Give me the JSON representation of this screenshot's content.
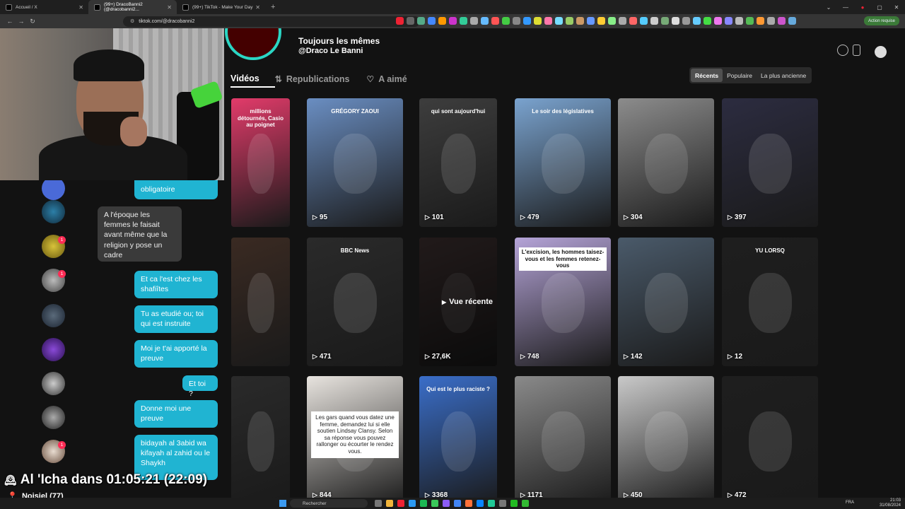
{
  "browser": {
    "tabs": [
      {
        "title": "Accueil / X",
        "active": false
      },
      {
        "title": "(99+) DracoBanni2 (@dracobanni2...",
        "active": true
      },
      {
        "title": "(99+) TikTok - Make Your Day",
        "active": false
      }
    ],
    "url": "tiktok.com/@dracobanni2",
    "action_pill": "Action requise"
  },
  "profile": {
    "bio_line1": "Toujours les mêmes",
    "bio_line2": "@Draco Le Banni",
    "tabs": [
      {
        "label": "Vidéos",
        "icon": "grid-icon",
        "active": true
      },
      {
        "label": "Republications",
        "icon": "repost-icon",
        "active": false
      },
      {
        "label": "A aimé",
        "icon": "heart-icon",
        "active": false
      }
    ],
    "sort_options": [
      {
        "label": "Récents",
        "active": true
      },
      {
        "label": "Populaire",
        "active": false
      },
      {
        "label": "La plus ancienne",
        "active": false
      }
    ]
  },
  "videos": [
    {
      "views": "",
      "caption": "millions détournés, Casio au poignet",
      "accent": "#e23b6a"
    },
    {
      "views": "95",
      "caption": "GRÉGORY ZAOUI",
      "accent": "#6a8ec2"
    },
    {
      "views": "101",
      "caption": "qui sont aujourd'hui",
      "accent": "#3d3d3d"
    },
    {
      "views": "479",
      "caption": "Le soir des législatives",
      "accent": "#7aa3cf"
    },
    {
      "views": "304",
      "caption": "",
      "accent": "#8c8c8c"
    },
    {
      "views": "397",
      "caption": "",
      "accent": "#2c2c40"
    },
    {
      "views": "",
      "caption": "",
      "accent": "#3a2a22"
    },
    {
      "views": "471",
      "caption": "BBC News",
      "accent": "#2a2a2a"
    },
    {
      "views": "27,6K",
      "caption": "Vue récente",
      "accent": "#4a3a3a"
    },
    {
      "views": "748",
      "caption": "L'excision, les hommes taisez-vous et les femmes retenez-vous",
      "accent": "#b5a4d8"
    },
    {
      "views": "142",
      "caption": "",
      "accent": "#4a5a6a"
    },
    {
      "views": "12",
      "caption": "YU LORSQ",
      "accent": "#1e1e1e"
    },
    {
      "views": "",
      "caption": "",
      "accent": "#2a2a2a"
    },
    {
      "views": "844",
      "caption": "Les gars quand vous datez une femme, demandez lui si elle soutien Lindsay Clansy. Selon sa réponse vous pouvez rallonger ou écourter le rendez vous.",
      "accent": "#e8e4df"
    },
    {
      "views": "3368",
      "caption": "Qui est le plus raciste ?",
      "accent": "#3a6ec9"
    },
    {
      "views": "1171",
      "caption": "",
      "accent": "#8a8a8a"
    },
    {
      "views": "450",
      "caption": "",
      "accent": "#c9c9c9"
    },
    {
      "views": "472",
      "caption": "",
      "accent": "#1e1e1e"
    }
  ],
  "chat": {
    "messages": [
      {
        "from": "me",
        "text": "obligatoire"
      },
      {
        "from": "them",
        "text": "A l'époque les femmes le faisait avant même que la religion y pose un cadre"
      },
      {
        "from": "me",
        "text": "Et ca l'est chez les shafiîtes"
      },
      {
        "from": "me",
        "text": "Tu as etudié ou; toi qui est instruite"
      },
      {
        "from": "me",
        "text": "Moi je t'ai apporté la preuve"
      },
      {
        "from": "me",
        "text": "Et toi ?"
      },
      {
        "from": "me",
        "text": "Donne moi une preuve"
      },
      {
        "from": "me",
        "text": "bidayah al 3abid wa kifayah al zahid ou le Shaykh"
      }
    ],
    "badges": [
      "1",
      "1",
      "1"
    ]
  },
  "overlay": {
    "prayer_time": "Al 'Icha dans 01:05:21 (22:09)",
    "location": "Noisiel (77)"
  },
  "taskbar": {
    "search": "Rechercher",
    "lang": "FRA",
    "time": "21:03",
    "date": "31/08/2024"
  }
}
